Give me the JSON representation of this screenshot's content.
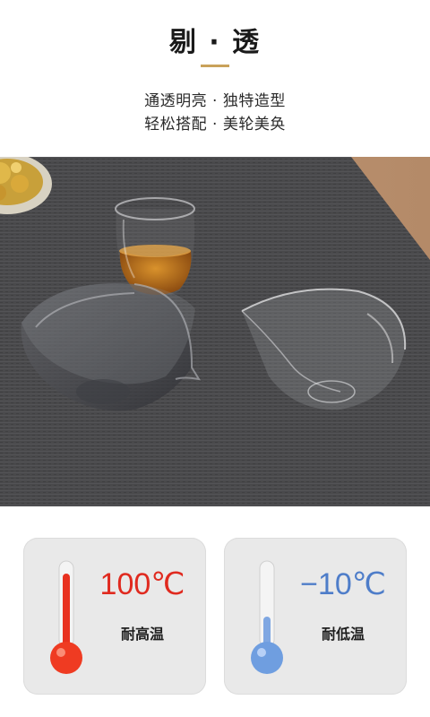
{
  "header": {
    "title": "剔 · 透",
    "subtitle_line1": "通透明亮 · 独特造型",
    "subtitle_line2": "轻松搭配 · 美轮美奂"
  },
  "badges": [
    {
      "temp": "100℃",
      "label": "耐高温",
      "color": "#e02a1f"
    },
    {
      "temp": "−10℃",
      "label": "耐低温",
      "color": "#4e7dc9"
    }
  ]
}
